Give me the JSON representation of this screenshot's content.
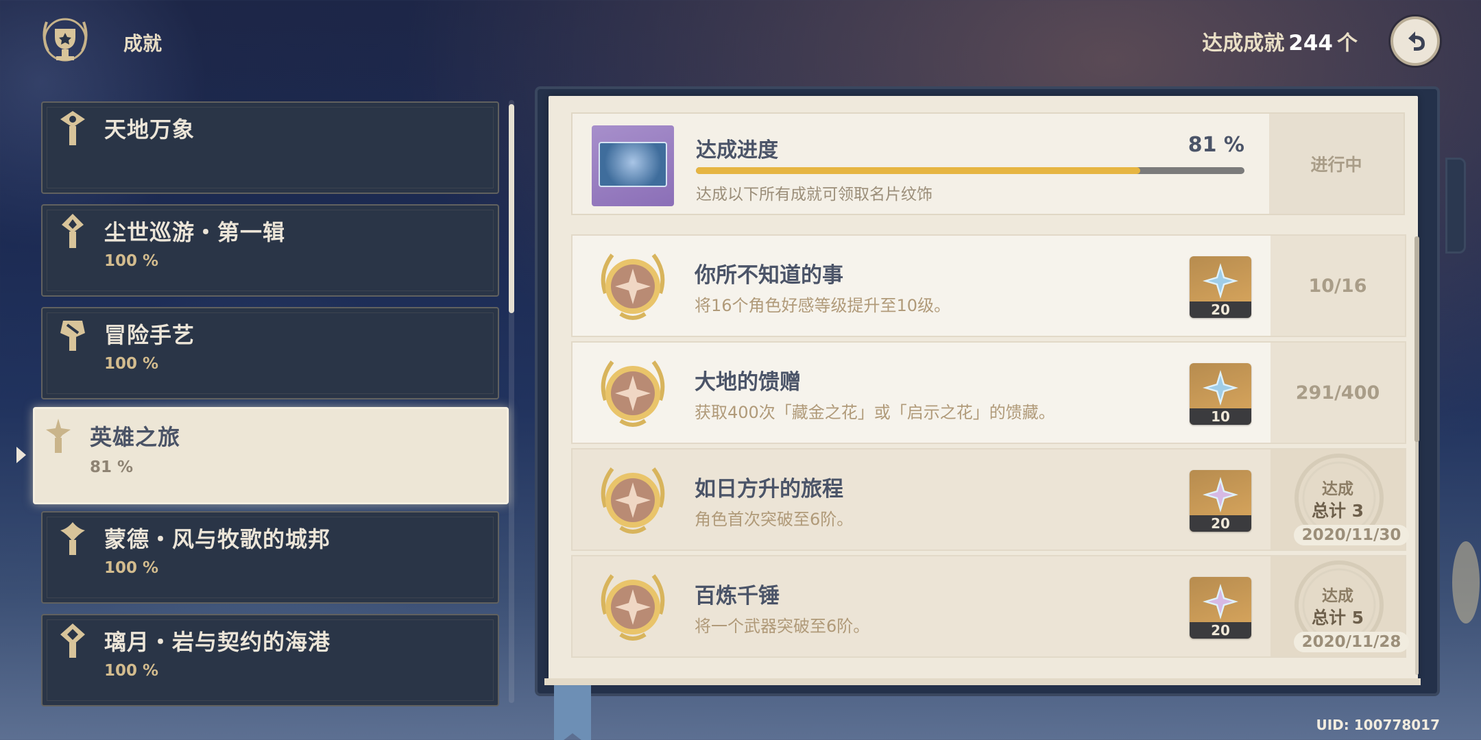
{
  "header": {
    "title": "成就",
    "count_label": "达成成就",
    "count_value": "244",
    "count_unit": "个"
  },
  "sidebar": {
    "items": [
      {
        "name": "天地万象",
        "percent": ""
      },
      {
        "name": "尘世巡游・第一辑",
        "percent": "100 %"
      },
      {
        "name": "冒险手艺",
        "percent": "100 %"
      },
      {
        "name": "英雄之旅",
        "percent": "81 %"
      },
      {
        "name": "蒙德・风与牧歌的城邦",
        "percent": "100 %"
      },
      {
        "name": "璃月・岩与契约的海港",
        "percent": "100 %"
      }
    ],
    "active_index": 3
  },
  "progress": {
    "title": "达成进度",
    "percent_text": "81 %",
    "fraction": 0.81,
    "description": "达成以下所有成就可领取名片纹饰",
    "status": "进行中"
  },
  "achievements": [
    {
      "name": "你所不知道的事",
      "description": "将16个角色好感等级提升至10级。",
      "reward": "20",
      "status": "10/16"
    },
    {
      "name": "大地的馈赠",
      "description": "获取400次「藏金之花」或「启示之花」的馈藏。",
      "reward": "10",
      "status": "291/400"
    },
    {
      "name": "如日方升的旅程",
      "description": "角色首次突破至6阶。",
      "reward": "20",
      "stamp_label": "达成",
      "stamp_total": "总计 3",
      "stamp_date": "2020/11/30"
    },
    {
      "name": "百炼千锤",
      "description": "将一个武器突破至6阶。",
      "reward": "20",
      "stamp_label": "达成",
      "stamp_total": "总计 5",
      "stamp_date": "2020/11/28"
    }
  ],
  "uid": "UID: 100778017",
  "colors": {
    "progress_fill": "#e6b542",
    "accent_gold": "#d3bc8e",
    "card_bg": "#2a3547",
    "paper": "#efe9dc"
  },
  "icons": {
    "header": "achievement-trophy-emblem-icon",
    "back": "back-arrow-icon",
    "reward": "primogem-icon",
    "medal": "achievement-medal-icon"
  }
}
